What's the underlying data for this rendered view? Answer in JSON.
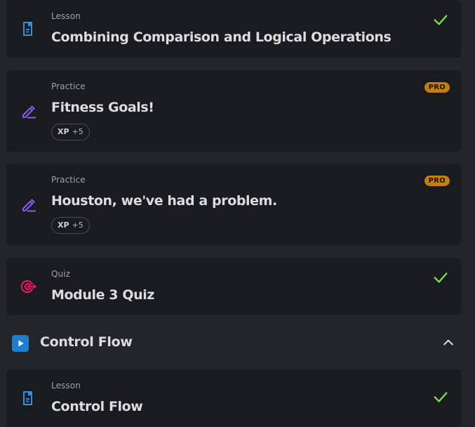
{
  "items": [
    {
      "kind": "Lesson",
      "title": "Combining Comparison and Logical Operations",
      "icon": "lesson-doc-icon",
      "completed": true
    },
    {
      "kind": "Practice",
      "title": "Fitness Goals!",
      "icon": "practice-pencil-icon",
      "badge": "PRO",
      "xp_label": "XP",
      "xp_value": "+5"
    },
    {
      "kind": "Practice",
      "title": "Houston, we've had a problem.",
      "icon": "practice-pencil-icon",
      "badge": "PRO",
      "xp_label": "XP",
      "xp_value": "+5"
    },
    {
      "kind": "Quiz",
      "title": "Module 3 Quiz",
      "icon": "quiz-target-icon",
      "completed": true
    }
  ],
  "section": {
    "title": "Control Flow",
    "icon": "play-icon",
    "expanded": true
  },
  "section_items": [
    {
      "kind": "Lesson",
      "title": "Control Flow",
      "icon": "lesson-doc-icon",
      "completed": true
    }
  ],
  "colors": {
    "background": "#232529",
    "card": "#1a1b1e",
    "lesson_icon": "#2f8fe0",
    "practice_icon": "#8b5cf6",
    "quiz_icon": "#e8165a",
    "check": "#7ddc54",
    "pro_badge": "#c47f09"
  }
}
